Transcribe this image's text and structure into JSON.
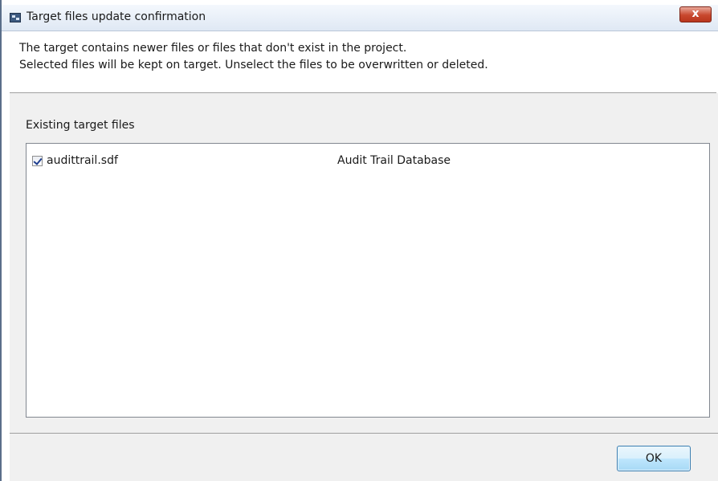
{
  "window": {
    "title": "Target files update confirmation",
    "close_label": "x"
  },
  "message": {
    "line1": "The target contains newer files or files that don't exist in the project.",
    "line2": "Selected files will be kept on target. Unselect the files to be overwritten or deleted."
  },
  "group": {
    "label": "Existing target files"
  },
  "files": [
    {
      "name": "audittrail.sdf",
      "description": "Audit Trail Database",
      "checked": true
    }
  ],
  "buttons": {
    "ok_label": "OK"
  },
  "colors": {
    "titlebar": "#dfe8f4",
    "close_button": "#c8472d",
    "panel_background": "#f0f0f0",
    "ok_button": "#bee6fd"
  },
  "icons": {
    "app": "app-window-icon",
    "close": "close-icon",
    "checkbox": "checkbox-checked-icon"
  }
}
